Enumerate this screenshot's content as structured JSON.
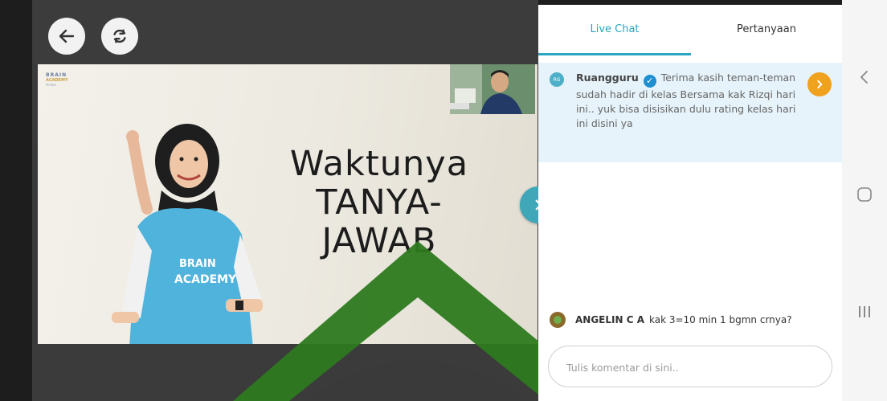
{
  "player": {
    "back_icon": "arrow-left-icon",
    "refresh_icon": "refresh-icon",
    "expand_icon": "chevron-right-icon"
  },
  "slide": {
    "title_lines": [
      "Waktunya",
      "TANYA-",
      "JAWAB"
    ],
    "logo_lines": [
      "BRAIN",
      "ACADEMY",
      "Online"
    ],
    "shirt_text": [
      "BRAIN",
      "ACADEMY"
    ]
  },
  "chat": {
    "tabs": [
      {
        "label": "Live Chat",
        "active": true
      },
      {
        "label": "Pertanyaan",
        "active": false
      }
    ],
    "pinned": {
      "avatar_text": "RG",
      "name": "Ruangguru",
      "text": "Terima kasih teman-teman sudah hadir di kelas Bersama kak Rizqi hari ini.. yuk bisa disisikan dulu rating kelas hari ini disini ya"
    },
    "messages": [
      {
        "name": "ANGELIN C A",
        "text": "kak 3=10 min 1 bgmn crnya?"
      }
    ],
    "input": {
      "placeholder": "Tulis komentar di sini..",
      "value": ""
    }
  },
  "colors": {
    "accent": "#2aa6bf",
    "pinned_bg": "#e6f3fa",
    "pinned_arrow": "#f0a21e",
    "overlay_green": "#2d7a1f"
  },
  "android_nav": [
    "back-nav-icon",
    "home-nav-icon",
    "recents-nav-icon"
  ]
}
